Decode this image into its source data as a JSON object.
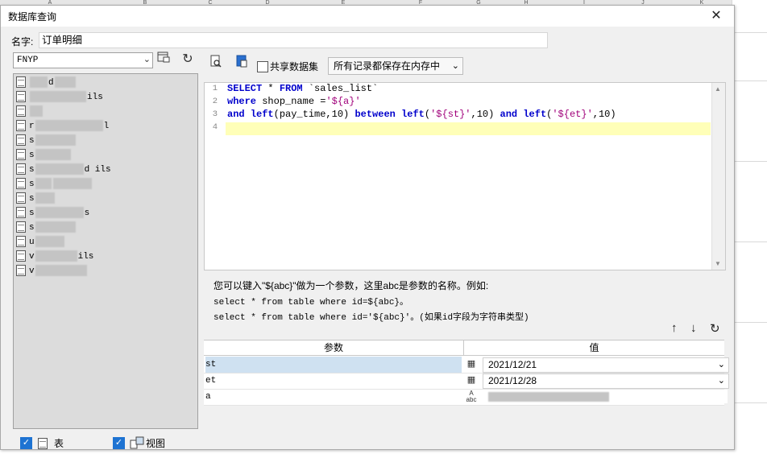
{
  "sheet": {
    "column_headers": [
      "A",
      "B",
      "C",
      "D",
      "E",
      "F",
      "G",
      "H",
      "I",
      "J",
      "K"
    ]
  },
  "dialog": {
    "title": "数据库查询",
    "close_glyph": "✕"
  },
  "name_field": {
    "label": "名字:",
    "value": "订单明细"
  },
  "left_panel": {
    "datasource": "FNYP",
    "tables": [
      {
        "prefix": "",
        "suffix": "d"
      },
      {
        "prefix": "",
        "suffix": "ils"
      },
      {
        "prefix": "",
        "suffix": ""
      },
      {
        "prefix": "r",
        "suffix": "l"
      },
      {
        "prefix": "s",
        "suffix": ""
      },
      {
        "prefix": "s",
        "suffix": ""
      },
      {
        "prefix": "s",
        "suffix": "d   ils"
      },
      {
        "prefix": "s",
        "suffix": ""
      },
      {
        "prefix": "s",
        "suffix": ""
      },
      {
        "prefix": "s",
        "suffix": "s"
      },
      {
        "prefix": "s",
        "suffix": ""
      },
      {
        "prefix": "u",
        "suffix": ""
      },
      {
        "prefix": "v",
        "suffix": "ils"
      },
      {
        "prefix": "v",
        "suffix": ""
      }
    ],
    "checks": {
      "table_label": "表",
      "view_label": "视图"
    }
  },
  "right_panel": {
    "share_label": "共享数据集",
    "memory_option": "所有记录都保存在内存中",
    "sql_line_numbers": [
      "1",
      "2",
      "3",
      "4"
    ],
    "help_text": "您可以键入\"${abc}\"做为一个参数，这里abc是参数的名称。例如:",
    "help_example1": "select * from table where id=${abc}。",
    "help_example2": "select * from table where id='${abc}'。(如果id字段为字符串类型)",
    "param_table": {
      "col_param": "参数",
      "col_value": "值",
      "rows": [
        {
          "name": "st",
          "value": "2021/12/21",
          "selected": true
        },
        {
          "name": "et",
          "value": "2021/12/28",
          "selected": false
        },
        {
          "name": "a",
          "value": "",
          "selected": false
        }
      ]
    }
  }
}
